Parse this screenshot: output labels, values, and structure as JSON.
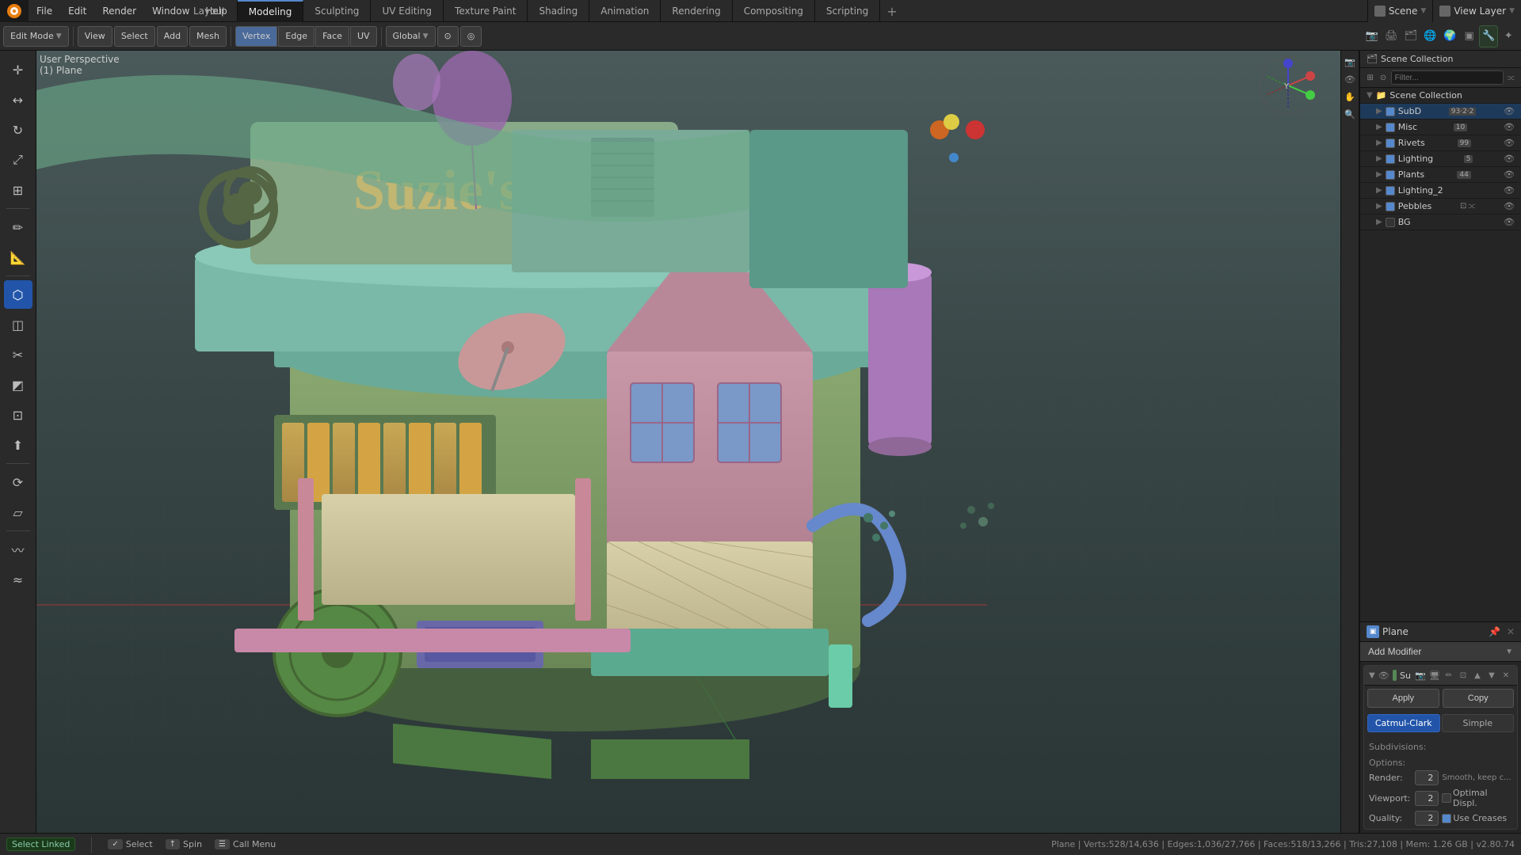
{
  "app": {
    "title": "Blender",
    "version": "v2.80.74"
  },
  "top_menu": {
    "items": [
      "File",
      "Edit",
      "Render",
      "Window",
      "Help"
    ]
  },
  "workspace_tabs": [
    {
      "label": "Layout",
      "active": false
    },
    {
      "label": "Modeling",
      "active": true
    },
    {
      "label": "Sculpting",
      "active": false
    },
    {
      "label": "UV Editing",
      "active": false
    },
    {
      "label": "Texture Paint",
      "active": false
    },
    {
      "label": "Shading",
      "active": false
    },
    {
      "label": "Animation",
      "active": false
    },
    {
      "label": "Rendering",
      "active": false
    },
    {
      "label": "Compositing",
      "active": false
    },
    {
      "label": "Scripting",
      "active": false
    }
  ],
  "scene": {
    "label": "Scene",
    "icon": "scene-icon"
  },
  "view_layer": {
    "label": "View Layer",
    "icon": "vl-icon"
  },
  "toolbar": {
    "mode": "Edit Mode",
    "view_label": "View",
    "select_label": "Select",
    "add_label": "Add",
    "mesh_label": "Mesh",
    "vertex_label": "Vertex",
    "edge_label": "Edge",
    "face_label": "Face",
    "uv_label": "UV",
    "transform_label": "Global",
    "snap_icon": "⊙",
    "proportional_icon": "◎"
  },
  "viewport": {
    "perspective_label": "User Perspective",
    "object_label": "(1) Plane"
  },
  "left_tools": [
    {
      "name": "cursor-tool",
      "icon": "✛",
      "active": false
    },
    {
      "name": "move-tool",
      "icon": "⊕",
      "active": false
    },
    {
      "name": "rotate-tool",
      "icon": "↻",
      "active": false
    },
    {
      "name": "scale-tool",
      "icon": "⤢",
      "active": false
    },
    {
      "name": "transform-tool",
      "icon": "⟲",
      "active": false
    },
    {
      "name": "separator-1",
      "separator": true
    },
    {
      "name": "annotate-tool",
      "icon": "✏",
      "active": false
    },
    {
      "name": "measure-tool",
      "icon": "📐",
      "active": false
    },
    {
      "name": "separator-2",
      "separator": true
    },
    {
      "name": "edit-tool",
      "icon": "✦",
      "active": true
    },
    {
      "name": "loop-cut-tool",
      "icon": "◫",
      "active": false
    },
    {
      "name": "knife-tool",
      "icon": "✂",
      "active": false
    },
    {
      "name": "bevel-tool",
      "icon": "◩",
      "active": false
    },
    {
      "name": "inset-tool",
      "icon": "⊡",
      "active": false
    },
    {
      "name": "extrude-tool",
      "icon": "⬆",
      "active": false
    },
    {
      "name": "separator-3",
      "separator": true
    },
    {
      "name": "spin-tool",
      "icon": "⟳",
      "active": false
    },
    {
      "name": "shear-tool",
      "icon": "▱",
      "active": false
    },
    {
      "name": "separator-4",
      "separator": true
    },
    {
      "name": "smooth-tool",
      "icon": "〰",
      "active": false
    },
    {
      "name": "relax-tool",
      "icon": "≈",
      "active": false
    }
  ],
  "outliner": {
    "title": "Scene Collection",
    "items": [
      {
        "name": "SubD",
        "indent": 1,
        "checked": true,
        "badge": "93·2·2",
        "has_children": false,
        "selected": true,
        "color": "orange"
      },
      {
        "name": "Misc",
        "indent": 1,
        "checked": true,
        "badge": "10",
        "has_children": false
      },
      {
        "name": "Rivets",
        "indent": 1,
        "checked": true,
        "badge": "99",
        "has_children": false
      },
      {
        "name": "Lighting",
        "indent": 1,
        "checked": true,
        "badge": "5",
        "has_children": false
      },
      {
        "name": "Plants",
        "indent": 1,
        "checked": true,
        "badge": "44",
        "has_children": false
      },
      {
        "name": "Lighting_2",
        "indent": 1,
        "checked": true,
        "has_children": false
      },
      {
        "name": "Pebbles",
        "indent": 1,
        "checked": true,
        "has_children": false
      },
      {
        "name": "BG",
        "indent": 1,
        "checked": false,
        "has_children": false
      }
    ]
  },
  "properties": {
    "object_name": "Plane",
    "add_modifier_label": "Add Modifier",
    "modifier": {
      "name": "Su",
      "full_name": "Subdivision Surface",
      "apply_label": "Apply",
      "copy_label": "Copy",
      "tabs": [
        {
          "label": "Catmul-Clark",
          "active": true
        },
        {
          "label": "Simple",
          "active": false
        }
      ],
      "subdivisions_label": "Subdivisions:",
      "options_label": "Options:",
      "render_label": "Render:",
      "render_value": "2",
      "viewport_label": "Viewport:",
      "viewport_value": "2",
      "quality_label": "Quality:",
      "quality_value": "2",
      "smooth_label": "Smooth, keep c...",
      "optimal_label": "Optimal Displ.",
      "use_creases_label": "Use Creases",
      "optimal_checked": false,
      "use_creases_checked": true
    }
  },
  "status_bar": {
    "select_label": "Select",
    "select_key": "✓",
    "spin_label": "Spin",
    "spin_key": "↑",
    "call_menu_label": "Call Menu",
    "call_menu_key": "☰",
    "select_linked_label": "Select Linked",
    "stats": "Plane | Verts:528/14,636 | Edges:1,036/27,766 | Faces:518/13,266 | Tris:27,108 | Mem: 1.26 GB | v2.80.74"
  },
  "colors": {
    "active_tab_accent": "#5588cc",
    "active_tool_bg": "#2255aa",
    "modifier_icon": "#558855",
    "scene_bg": "#393939",
    "header_bg": "#2a2a2a",
    "panel_bg": "#252525"
  }
}
